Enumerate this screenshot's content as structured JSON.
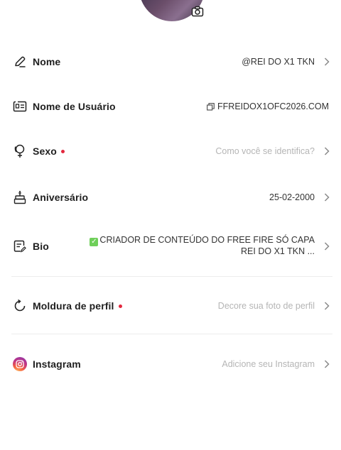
{
  "profile": {
    "avatar_alt": "profile picture",
    "camera_icon": "camera-icon"
  },
  "fields": {
    "nome": {
      "label": "Nome",
      "value": "@REI DO X1 TKN"
    },
    "usuario": {
      "label": "Nome de Usuário",
      "value": "FFREIDOX1OFC2026.COM"
    },
    "sexo": {
      "label": "Sexo",
      "value": "Como você se identifica?"
    },
    "aniversario": {
      "label": "Aniversário",
      "value": "25-02-2000"
    },
    "bio": {
      "label": "Bio",
      "value": "CRIADOR DE CONTEÚDO DO FREE FIRE SÓ CAPA  REI DO X1 TKN ..."
    },
    "moldura": {
      "label": "Moldura de perfil",
      "value": "Decore sua foto de perfil"
    },
    "instagram": {
      "label": "Instagram",
      "value": "Adicione seu Instagram"
    }
  },
  "colors": {
    "required_dot": "#e3283e",
    "hint_text": "#b5b5b5"
  }
}
